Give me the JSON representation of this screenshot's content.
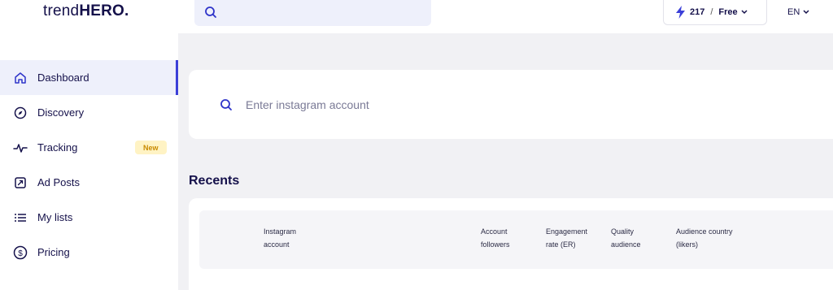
{
  "brand": {
    "light": "trend",
    "bold": "HERO",
    "dot": "."
  },
  "topbar": {
    "search_icon": "search-icon",
    "credits": {
      "count": "217",
      "separator": "/",
      "plan": "Free"
    },
    "language": "EN"
  },
  "sidebar": {
    "items": [
      {
        "label": "Dashboard",
        "icon": "home-icon",
        "active": true
      },
      {
        "label": "Discovery",
        "icon": "compass-icon"
      },
      {
        "label": "Tracking",
        "icon": "activity-icon",
        "badge": "New"
      },
      {
        "label": "Ad Posts",
        "icon": "ad-icon"
      },
      {
        "label": "My lists",
        "icon": "list-icon"
      },
      {
        "label": "Pricing",
        "icon": "dollar-icon"
      }
    ]
  },
  "main": {
    "search": {
      "placeholder": "Enter instagram account"
    },
    "recents": {
      "title": "Recents",
      "columns": [
        {
          "line1": "Instagram",
          "line2": "account"
        },
        {
          "line1": "Account",
          "line2": "followers"
        },
        {
          "line1": "Engagement",
          "line2": "rate (ER)"
        },
        {
          "line1": "Quality",
          "line2": "audience"
        },
        {
          "line1": "Audience country",
          "line2": "(likers)"
        }
      ]
    }
  },
  "colors": {
    "accent": "#3b3fd8",
    "text": "#14104a",
    "badge_bg": "#fff3c4",
    "badge_text": "#c98a00",
    "page_bg": "#f1f1f4",
    "active_bg": "#eef0fb"
  }
}
